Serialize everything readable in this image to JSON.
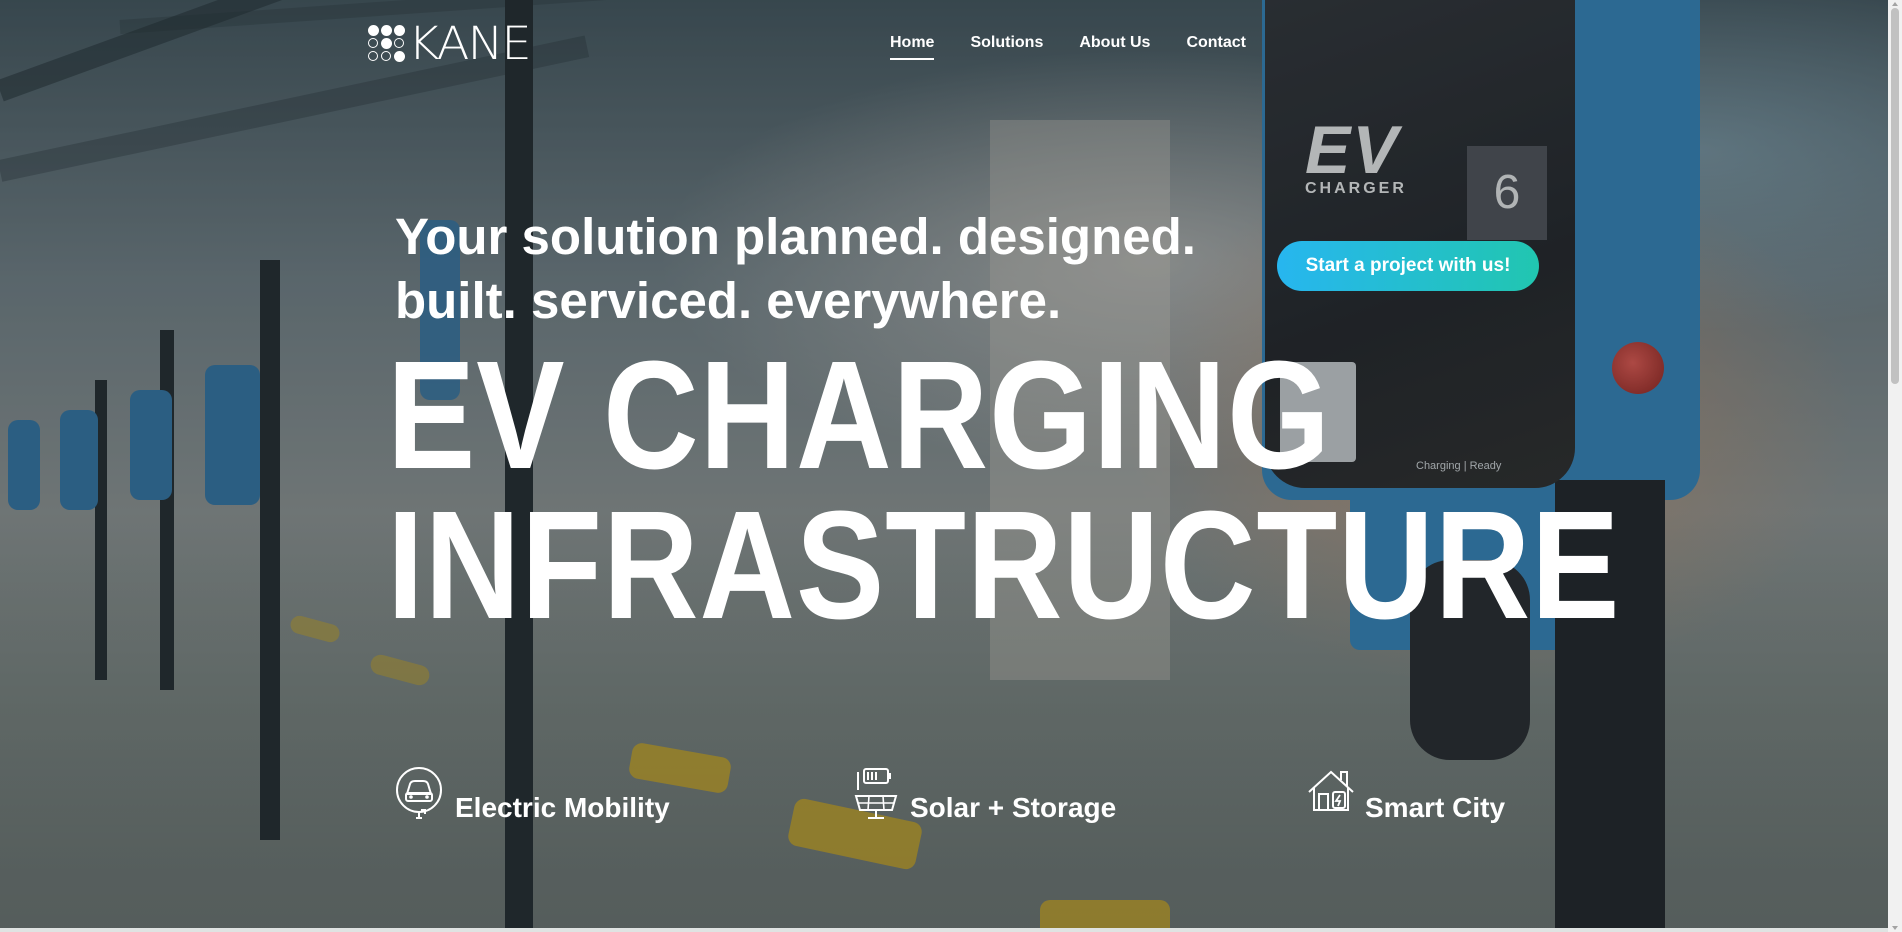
{
  "brand": {
    "logo_text": "KANE"
  },
  "nav": {
    "items": [
      {
        "label": "Home",
        "active": true
      },
      {
        "label": "Solutions",
        "active": false
      },
      {
        "label": "About Us",
        "active": false
      },
      {
        "label": "Contact",
        "active": false
      }
    ]
  },
  "hero": {
    "tagline_line1": "Your solution planned. designed.",
    "tagline_line2": "built. serviced. everywhere.",
    "headline_line1": "EV CHARGING",
    "headline_line2": "INFRASTRUCTURE",
    "cta_label": "Start a project with us!"
  },
  "background": {
    "charger_brand": "EV",
    "charger_sub": "CHARGER",
    "charger_number": "6",
    "charger_status": "Charging | Ready"
  },
  "features": [
    {
      "label": "Electric Mobility",
      "icon": "electric-car-icon"
    },
    {
      "label": "Solar + Storage",
      "icon": "solar-panel-battery-icon"
    },
    {
      "label": "Smart City",
      "icon": "smart-house-icon"
    }
  ],
  "colors": {
    "cta_gradient_start": "#27b6ef",
    "cta_gradient_end": "#21c6b0",
    "text": "#ffffff"
  }
}
